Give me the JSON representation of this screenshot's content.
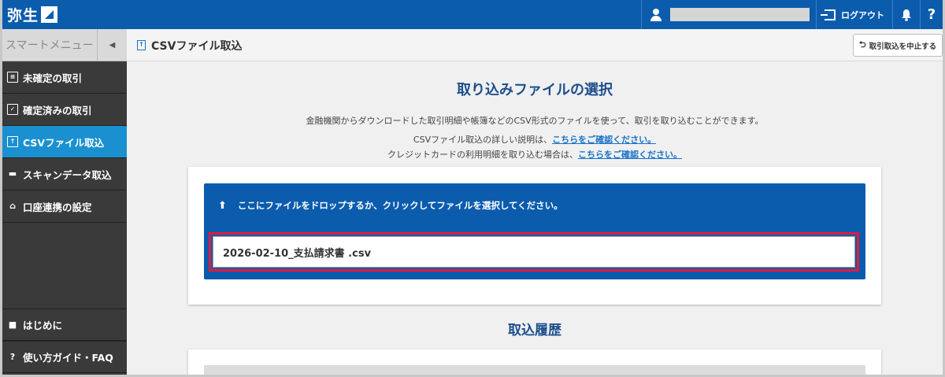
{
  "header": {
    "logo_text": "弥生",
    "logout_label": "ログアウト",
    "help_label": "?"
  },
  "sidebar": {
    "title": "スマートメニュー",
    "items": [
      {
        "label": "未確定の取引",
        "icon": "document-list-icon"
      },
      {
        "label": "確定済みの取引",
        "icon": "checked-document-icon"
      },
      {
        "label": "CSVファイル取込",
        "icon": "file-upload-icon",
        "active": true
      },
      {
        "label": "スキャンデータ取込",
        "icon": "scanner-icon"
      },
      {
        "label": "口座連携の設定",
        "icon": "bank-icon"
      }
    ],
    "bottom_items": [
      {
        "label": "はじめに",
        "icon": "book-icon"
      },
      {
        "label": "使い方ガイド・FAQ",
        "icon": "question-circle-icon"
      }
    ]
  },
  "subheader": {
    "page_title": "CSVファイル取込",
    "cancel_label": "取引取込を中止する"
  },
  "main": {
    "title": "取り込みファイルの選択",
    "description": "金融機関からダウンロードした取引明細や帳簿などのCSV形式のファイルを使って、取引を取り込むことができます。",
    "detail_prefix": "CSVファイル取込の詳しい説明は、",
    "detail_link": "こちらをご確認ください。",
    "credit_prefix": "クレジットカードの利用明細を取り込む場合は、",
    "credit_link": "こちらをご確認ください。",
    "drop_message": "ここにファイルをドロップするか、クリックしてファイルを選択してください。",
    "selected_file": "2026-02-10_支払請求書 .csv",
    "history_title": "取込履歴"
  },
  "colors": {
    "header_blue": "#0b5cad",
    "sidebar_active": "#1a90d0",
    "highlight_red": "#e5193a"
  }
}
